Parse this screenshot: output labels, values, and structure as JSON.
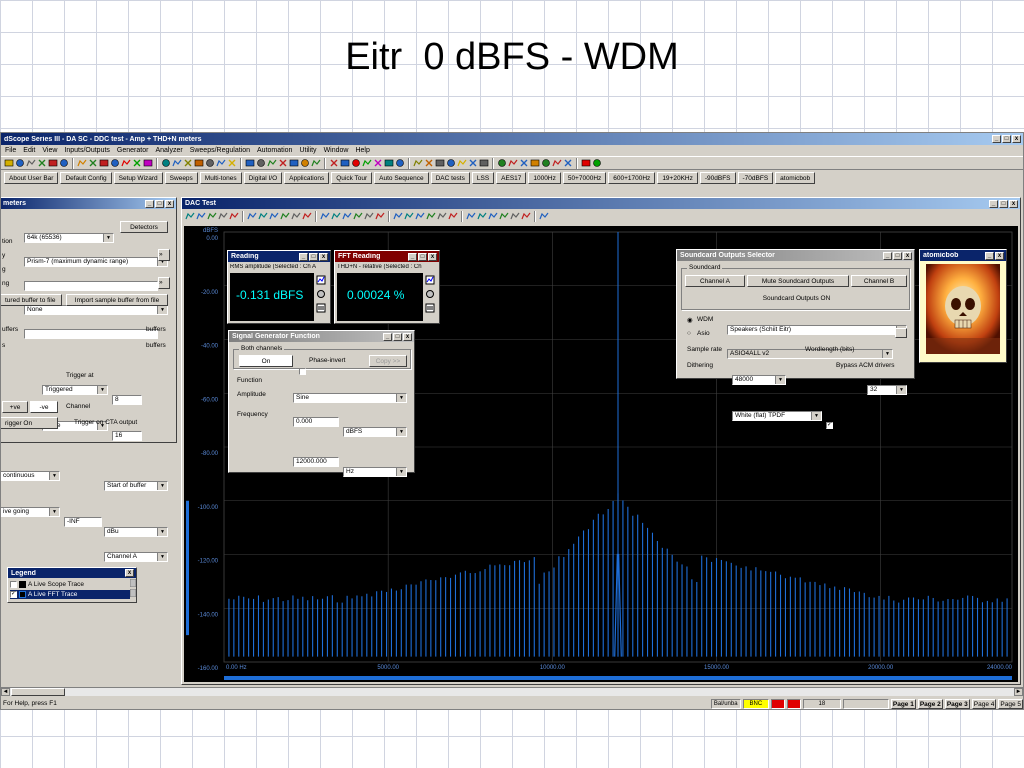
{
  "slide_title": "Eitr  0 dBFS - WDM",
  "app": {
    "title": "dScope Series III - DA SC - DDC test - Amp + THD+N meters",
    "menu": [
      "File",
      "Edit",
      "View",
      "Inputs/Outputs",
      "Generator",
      "Analyzer",
      "Sweeps/Regulation",
      "Automation",
      "Utility",
      "Window",
      "Help"
    ],
    "buttons": [
      "About User Bar",
      "Default Config",
      "Setup Wizard",
      "Sweeps",
      "Multi-tones",
      "Digital I/O",
      "Applications",
      "Quick Tour",
      "Auto Sequence",
      "DAC tests",
      "LSS",
      "AES17",
      "1000Hz",
      "50+7000Hz",
      "600+1700Hz",
      "19+20KHz",
      "-90dBFS",
      "-70dBFS",
      "atomicbob"
    ]
  },
  "detectors_panel": {
    "title": "meters",
    "buffer_size": "64k (65536)",
    "detectors_btn": "Detectors",
    "window": "Prism-7 (maximum dynamic range)",
    "fn_label_1": "tion",
    "fn_label_2": "y",
    "fn_label_3": "g",
    "fn_label_4": "ng",
    "source": "None",
    "save_btn": "tured buffer to file",
    "import_btn": "Import sample buffer from file",
    "buffers_lbl": "uffers",
    "trigger_mode": "Triggered",
    "buffers_count_1": "8",
    "buffers_unit": "buffers",
    "once": "Once",
    "buffers_count_2": "16",
    "cont": "continuous",
    "trigger_at_lbl": "Trigger at",
    "trigger_at": "Start of buffer",
    "edge": "ive going",
    "level": "-INF",
    "level_unit": "dBu",
    "pos_btn": "+ve",
    "neg_btn": "-ve",
    "channel_lbl": "Channel",
    "channel": "Channel A",
    "trig_on_btn": "rigger On",
    "cta_lbl": "Trigger on CTA output"
  },
  "dac_window": {
    "title": "DAC Test",
    "y_unit": "dBFS",
    "y_ticks": [
      "0.00",
      "-20.00",
      "-40.00",
      "-60.00",
      "-80.00",
      "-100.00",
      "-120.00",
      "-140.00",
      "-160.00"
    ],
    "x_ticks": [
      "0.00 Hz",
      "5000.00",
      "10000.00",
      "15000.00",
      "20000.00",
      "24000.00"
    ]
  },
  "reading": {
    "title": "Reading",
    "sub": "RMS amplitude (Selected : Ch A",
    "value": "-0.131 dBFS"
  },
  "fft_reading": {
    "title": "FFT Reading",
    "sub": "THD+N - relative (Selected : Ch",
    "value": "0.00024 %"
  },
  "siggen": {
    "title": "Signal Generator Function",
    "group": "Both channels",
    "on_btn": "On",
    "phase_invert": "Phase-invert",
    "copy_btn": "Copy >>",
    "function_lbl": "Function",
    "function": "Sine",
    "amplitude_lbl": "Amplitude",
    "amplitude": "0.000",
    "amplitude_unit": "dBFS",
    "frequency_lbl": "Frequency",
    "frequency": "12000.000",
    "frequency_unit": "Hz"
  },
  "soundcard": {
    "title": "Soundcard Outputs Selector",
    "group": "Soundcard",
    "channel_a": "Channel A",
    "mute": "Mute Soundcard Outputs",
    "channel_b": "Channel B",
    "status": "Soundcard Outputs ON",
    "wdm_lbl": "WDM",
    "wdm_value": "Speakers (Schiit Eitr)",
    "asio_lbl": "Asio",
    "asio_value": "ASIO4ALL v2",
    "samplerate_lbl": "Sample rate",
    "samplerate": "48000",
    "wordlength_lbl": "Wordlength (bits)",
    "wordlength": "32",
    "dither_lbl": "Dithering",
    "dither": "White (flat) TPDF",
    "bypass_lbl": "Bypass ACM drivers"
  },
  "atomic": {
    "title": "atomicbob"
  },
  "legend": {
    "title": "Legend",
    "items": [
      "A Live Scope Trace",
      "A Live FFT Trace"
    ]
  },
  "status": {
    "help": "For Help, press F1",
    "bal": "Bal/unba",
    "bnc": "BNC",
    "num": "18",
    "pages": [
      "Page 1",
      "Page 2",
      "Page 3",
      "Page 4",
      "Page 5"
    ]
  },
  "colors": {
    "trace": "#1e6ed8",
    "bnc": "#ffff00",
    "alarm": "#e00000"
  }
}
